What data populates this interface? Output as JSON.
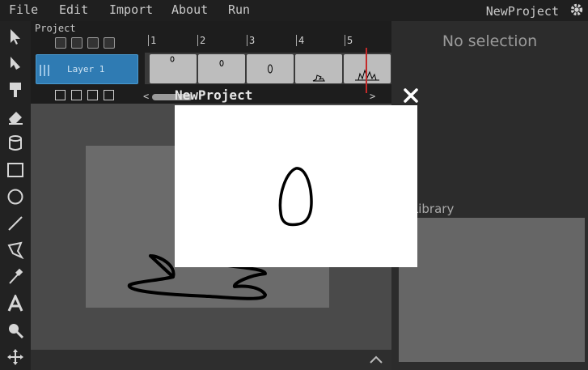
{
  "menu": {
    "file": "File",
    "edit": "Edit",
    "import": "Import",
    "about": "About",
    "run": "Run",
    "project_name": "NewProject"
  },
  "timeline": {
    "title": "Project",
    "frame_numbers": [
      "1",
      "2",
      "3",
      "4",
      "5"
    ],
    "layer_name": "Layer 1"
  },
  "inspector": {
    "empty_text": "No selection"
  },
  "asset_library": {
    "title": "et Library"
  },
  "popup": {
    "title": "NewProject",
    "close_icon": "close-icon"
  },
  "tools": [
    "select-icon",
    "transform-icon",
    "brush-icon",
    "eraser-icon",
    "fill-bucket-icon",
    "rectangle-icon",
    "ellipse-icon",
    "line-icon",
    "pen-icon",
    "eyedropper-icon",
    "text-icon",
    "zoom-icon",
    "pan-icon"
  ],
  "colors": {
    "layer_selected": "#2f7bb3",
    "playhead": "#c42a2a"
  }
}
